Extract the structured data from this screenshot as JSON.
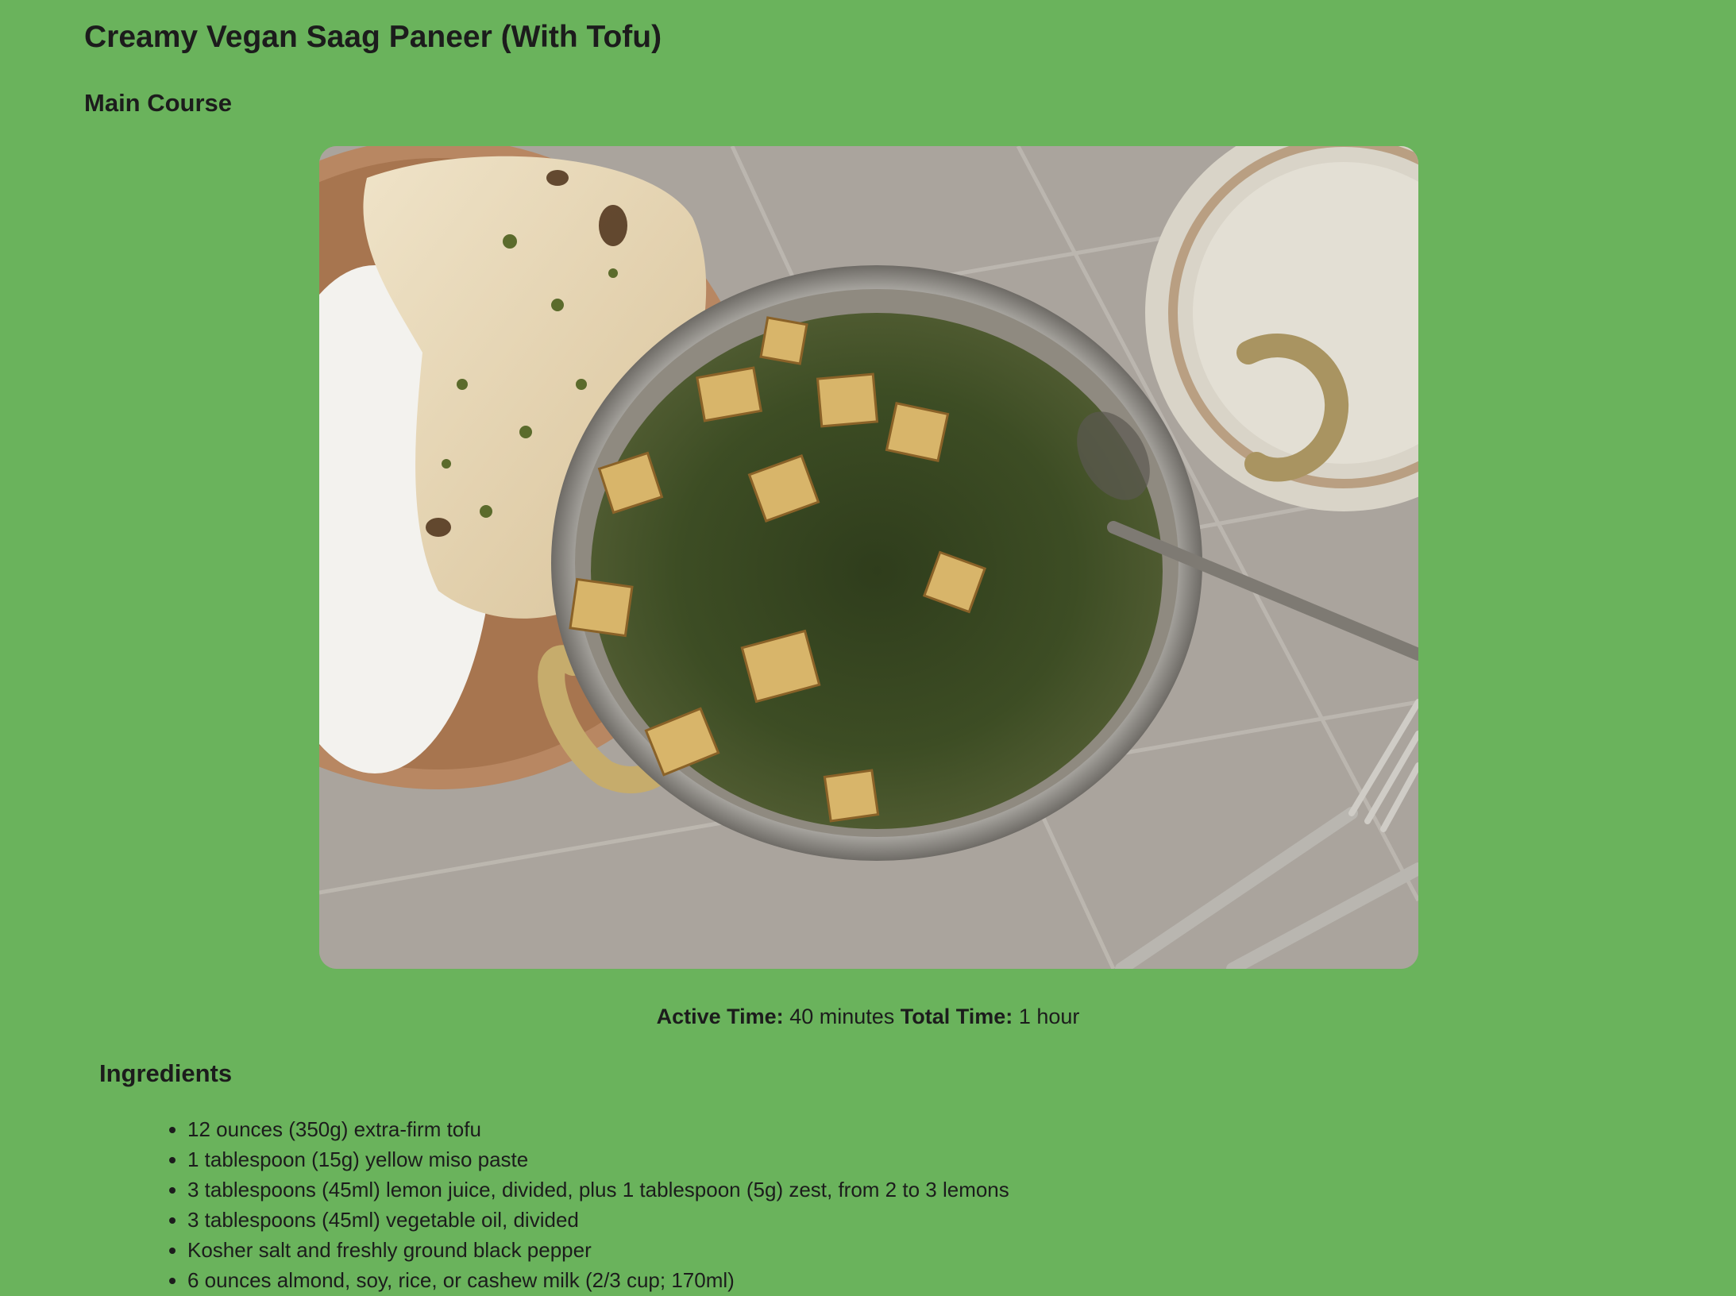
{
  "recipe": {
    "title": "Creamy Vegan Saag Paneer (With Tofu)",
    "category": "Main Course",
    "image_subject": "saag paneer with tofu in a brass-handled bowl, naan and rice on a plate",
    "times": {
      "active_label": "Active Time:",
      "active_value": "40 minutes",
      "total_label": "Total Time:",
      "total_value": "1 hour"
    },
    "ingredients_heading": "Ingredients",
    "ingredients": [
      "12 ounces (350g) extra-firm tofu",
      "1 tablespoon (15g) yellow miso paste",
      "3 tablespoons (45ml) lemon juice, divided, plus 1 tablespoon (5g) zest, from 2 to 3 lemons",
      "3 tablespoons (45ml) vegetable oil, divided",
      "Kosher salt and freshly ground black pepper",
      "6 ounces almond, soy, rice, or cashew milk (2/3 cup; 170ml)"
    ]
  },
  "colors": {
    "background": "#6ab35c",
    "text": "#1c1c1c"
  }
}
